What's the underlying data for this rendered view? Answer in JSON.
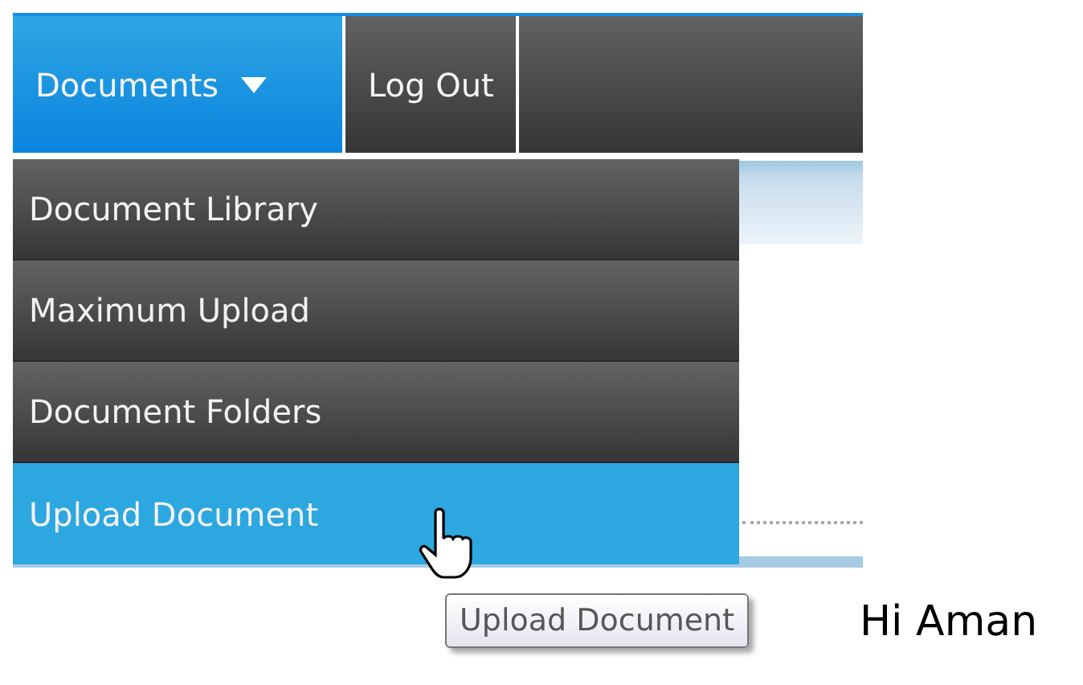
{
  "nav": {
    "items": [
      {
        "label": "Documents",
        "selected": true,
        "has_caret": true
      },
      {
        "label": "Log Out",
        "selected": false,
        "has_caret": false
      }
    ]
  },
  "dropdown": {
    "items": [
      {
        "label": "Document Library",
        "selected": false
      },
      {
        "label": "Maximum Upload",
        "selected": false
      },
      {
        "label": "Document Folders",
        "selected": false
      },
      {
        "label": "Upload Document",
        "selected": true
      }
    ]
  },
  "tooltip": {
    "text": "Upload Document"
  },
  "greeting": "Hi Aman"
}
